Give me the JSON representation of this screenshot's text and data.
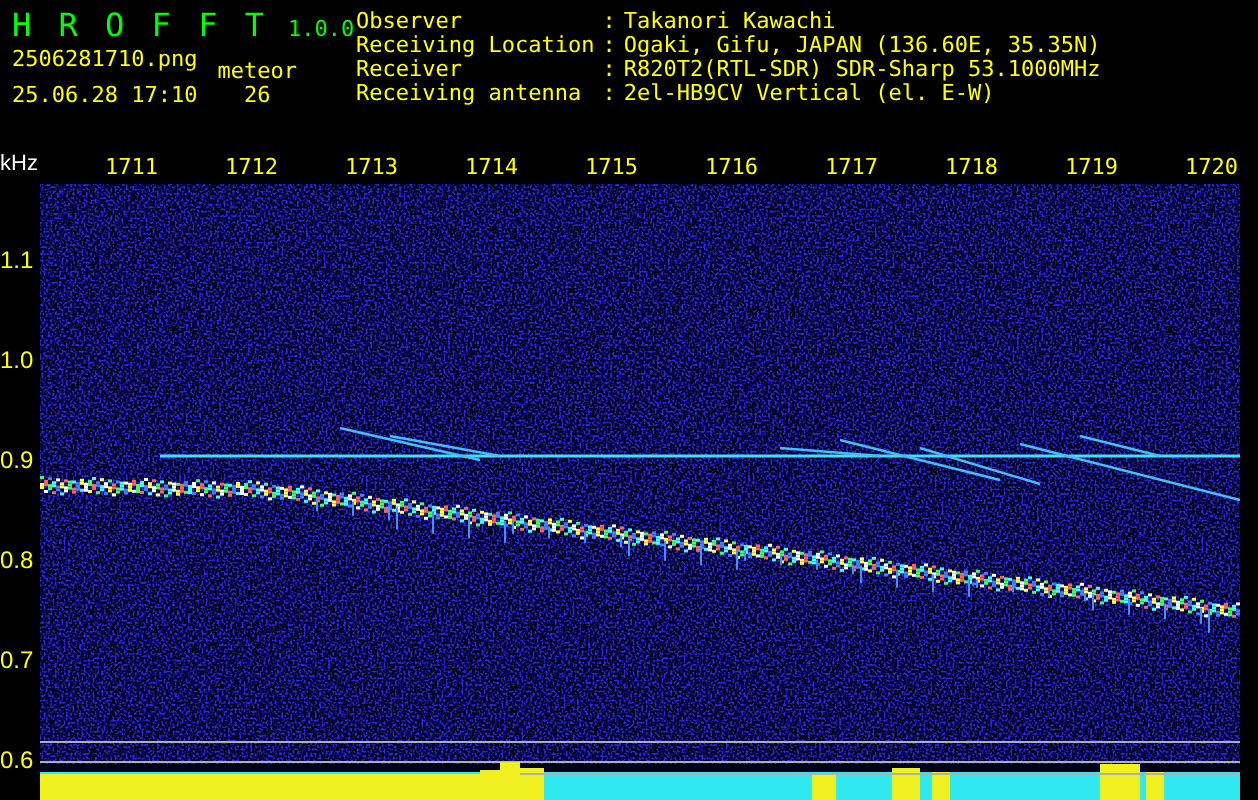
{
  "header": {
    "app_name": "H R O F F T",
    "version": "1.0.0",
    "filename": "2506281710.png",
    "timestamp": "25.06.28 17:10",
    "meteor_label": "meteor",
    "meteor_count": "26"
  },
  "station_info": [
    {
      "label": "Observer",
      "value": "Takanori Kawachi"
    },
    {
      "label": "Receiving Location",
      "value": "Ogaki, Gifu, JAPAN (136.60E, 35.35N)"
    },
    {
      "label": "Receiver",
      "value": "R820T2(RTL-SDR) SDR-Sharp 53.1000MHz"
    },
    {
      "label": "Receiving antenna",
      "value": "2el-HB9CV Vertical (el. E-W)"
    }
  ],
  "separator": ":",
  "y_unit": "kHz",
  "time_ticks": [
    "1711",
    "1712",
    "1713",
    "1714",
    "1715",
    "1716",
    "1717",
    "1718",
    "1719",
    "1720"
  ],
  "freq_ticks": [
    "1.1",
    "1.0",
    "0.9",
    "0.8",
    "0.7",
    "0.6"
  ]
}
